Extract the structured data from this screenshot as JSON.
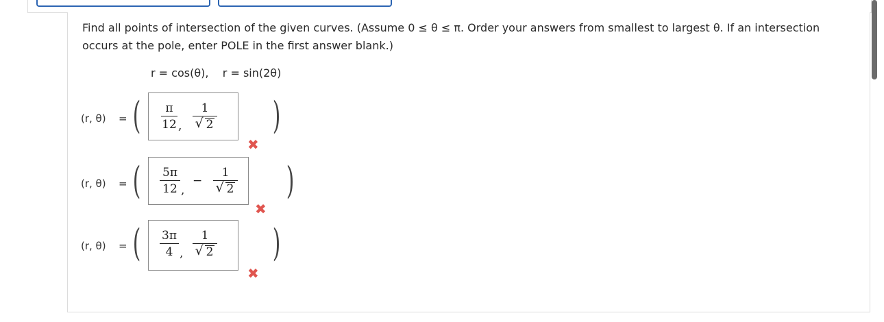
{
  "question": {
    "text": "Find all points of intersection of the given curves. (Assume 0 ≤ θ ≤ π. Order your answers from smallest to largest θ. If an intersection occurs at the pole, enter POLE in the first answer blank.)"
  },
  "curves": {
    "text": "r = cos(θ),    r = sin(2θ)"
  },
  "rows": [
    {
      "label": "(r, θ)",
      "equals": "=",
      "open_paren": "(",
      "close_paren": ")",
      "first": {
        "num": "π",
        "den": "12"
      },
      "sep": ",",
      "sign": "",
      "second": {
        "num": "1",
        "den_radicand": "2"
      },
      "status": "incorrect-icon",
      "mark": "✖"
    },
    {
      "label": "(r, θ)",
      "equals": "=",
      "open_paren": "(",
      "close_paren": ")",
      "first": {
        "num": "5π",
        "den": "12"
      },
      "sep": ",",
      "sign": "−",
      "second": {
        "num": "1",
        "den_radicand": "2"
      },
      "status": "incorrect-icon",
      "mark": "✖"
    },
    {
      "label": "(r, θ)",
      "equals": "=",
      "open_paren": "(",
      "close_paren": ")",
      "first": {
        "num": "3π",
        "den": "4"
      },
      "sep": ",",
      "sign": "",
      "second": {
        "num": "1",
        "den_radicand": "2"
      },
      "status": "incorrect-icon",
      "mark": "✖"
    }
  ],
  "colors": {
    "incorrect": "#e0554f",
    "accent": "#2b64b2"
  }
}
